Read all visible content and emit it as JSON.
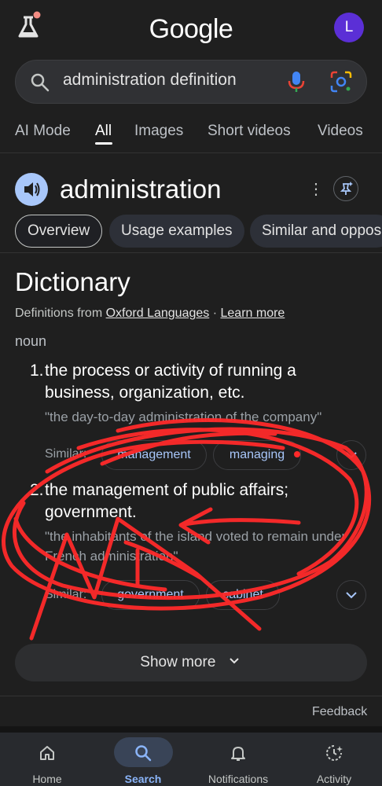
{
  "header": {
    "logo": "Google",
    "avatar_letter": "L"
  },
  "search": {
    "query": "administration definition"
  },
  "tabs": [
    {
      "label": "AI Mode"
    },
    {
      "label": "All"
    },
    {
      "label": "Images"
    },
    {
      "label": "Short videos"
    },
    {
      "label": "Videos"
    }
  ],
  "word": {
    "title": "administration"
  },
  "chips": [
    {
      "label": "Overview"
    },
    {
      "label": "Usage examples"
    },
    {
      "label": "Similar and oppos"
    }
  ],
  "dictionary": {
    "title": "Dictionary",
    "source_prefix": "Definitions from",
    "source_link": "Oxford Languages",
    "separator": "·",
    "learn_more": "Learn more",
    "pos": "noun",
    "definitions": [
      {
        "number": "1.",
        "text": "the process or activity of running a business, organization, etc.",
        "example": "\"the day-to-day administration of the company\"",
        "similar_label": "Similar:",
        "similar": [
          "management",
          "managing"
        ]
      },
      {
        "number": "2.",
        "text": "the management of public affairs; government.",
        "example": "\"the inhabitants of the island voted to remain under French administration\"",
        "similar_label": "Similar:",
        "similar": [
          "government",
          "cabinet"
        ]
      }
    ],
    "show_more": "Show more"
  },
  "feedback": "Feedback",
  "nav": [
    {
      "label": "Home"
    },
    {
      "label": "Search"
    },
    {
      "label": "Notifications"
    },
    {
      "label": "Activity"
    }
  ],
  "colors": {
    "background": "#1f1f1f",
    "accent": "#8ab4f8",
    "annotation": "#ff2a2a",
    "avatar": "#5b2fd6"
  }
}
